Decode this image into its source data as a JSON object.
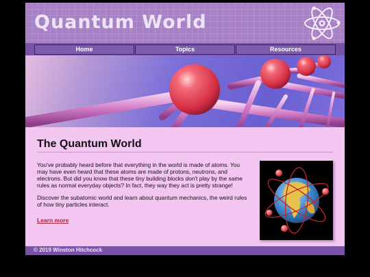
{
  "header": {
    "title": "Quantum World",
    "logo_icon": "atom-icon"
  },
  "nav": {
    "items": [
      {
        "label": "Home"
      },
      {
        "label": "Topics"
      },
      {
        "label": "Resources"
      }
    ]
  },
  "banner": {
    "image": "molecule-spheres-banner"
  },
  "main": {
    "heading": "The Quantum World",
    "paragraphs": [
      "You've probably heard before that everything in the world is made of atoms. You may have even heard that these atoms are made of protons, neutrons, and electrons. But did you know that these tiny building blocks don't play by the same rules as normal everyday objects? In fact, they way they act is pretty strange!",
      "Discover the subatomic world and learn about quantum mechanics, the weird rules of how tiny particles interact."
    ],
    "link": "Learn more",
    "image": "globe-with-orbits-image"
  },
  "footer": {
    "copyright": "© 2019 Winston Hitchcock"
  },
  "colors": {
    "page_background": "#f3c6f1",
    "header": "#a880c6",
    "nav_bar": "#7853a6",
    "link": "#b01f3b"
  }
}
